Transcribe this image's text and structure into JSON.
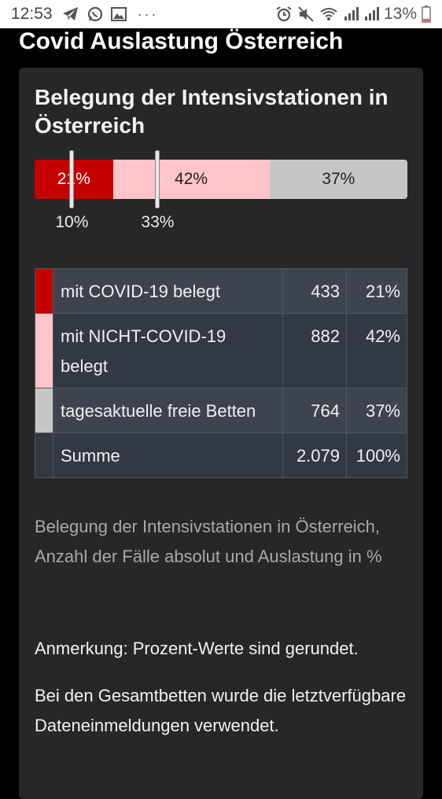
{
  "status_bar": {
    "time": "12:53",
    "left_icons": [
      "telegram-icon",
      "whatsapp-icon",
      "gallery-icon"
    ],
    "more": "···",
    "right_icons": [
      "alarm-icon",
      "mute-icon",
      "wifi-icon",
      "signal-icon",
      "signal-icon"
    ],
    "battery_text": "13%"
  },
  "page": {
    "title": "Covid Auslastung Österreich"
  },
  "card": {
    "title": "Belegung der Intensivstationen in Österreich",
    "bar": {
      "segments": [
        {
          "label": "21%",
          "value": 21,
          "color": "#c40000"
        },
        {
          "label": "42%",
          "value": 42,
          "color": "#ffc5c8"
        },
        {
          "label": "37%",
          "value": 37,
          "color": "#c6c6c6"
        }
      ],
      "markers": [
        {
          "label": "10%",
          "value": 10
        },
        {
          "label": "33%",
          "value": 33
        }
      ]
    },
    "table": {
      "rows": [
        {
          "label": "mit COVID-19 belegt",
          "absolute": "433",
          "percent": "21%",
          "color": "#c40000"
        },
        {
          "label": "mit NICHT-COVID-19 belegt",
          "absolute": "882",
          "percent": "42%",
          "color": "#ffc5c8"
        },
        {
          "label": "tagesaktuelle freie Betten",
          "absolute": "764",
          "percent": "37%",
          "color": "#c6c6c6"
        },
        {
          "label": "Summe",
          "absolute": "2.079",
          "percent": "100%",
          "color": ""
        }
      ]
    },
    "caption": "Belegung der Intensivstationen in Österreich, Anzahl der Fälle absolut und Auslastung in %",
    "note1": "Anmerkung: Prozent-Werte sind gerundet.",
    "note2": "Bei den Gesamtbetten wurde die letztverfügbare Dateneinmeldungen verwendet."
  }
}
